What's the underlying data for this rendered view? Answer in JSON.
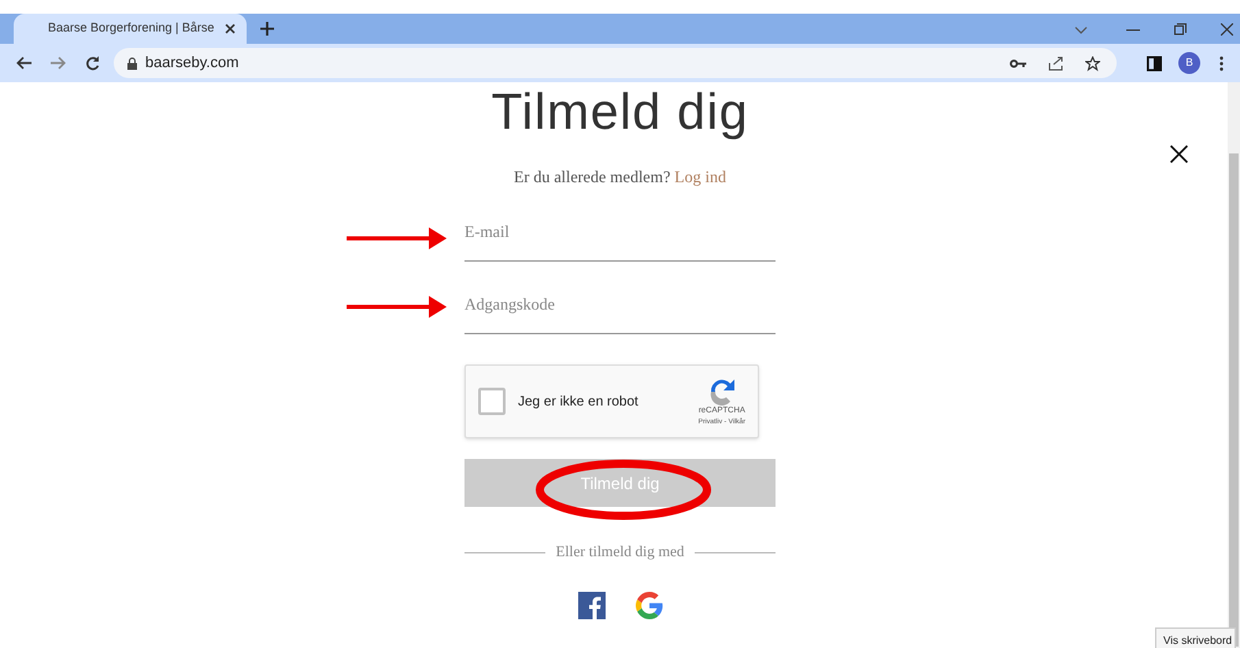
{
  "browser": {
    "tab_title": "Baarse Borgerforening | Bårse",
    "url": "baarseby.com",
    "profile_initial": "B"
  },
  "page": {
    "title": "Tilmeld dig",
    "member_prompt": "Er du allerede medlem?",
    "login_link": "Log ind",
    "fields": [
      {
        "placeholder": "E-mail"
      },
      {
        "placeholder": "Adgangskode"
      }
    ],
    "captcha": {
      "label": "Jeg er ikke en robot",
      "checked": false,
      "brand": "reCAPTCHA",
      "links": "Privatliv - Vilkår"
    },
    "submit": "Tilmeld dig",
    "divider": "Eller tilmeld dig med"
  },
  "tooltip": "Vis skrivebord"
}
